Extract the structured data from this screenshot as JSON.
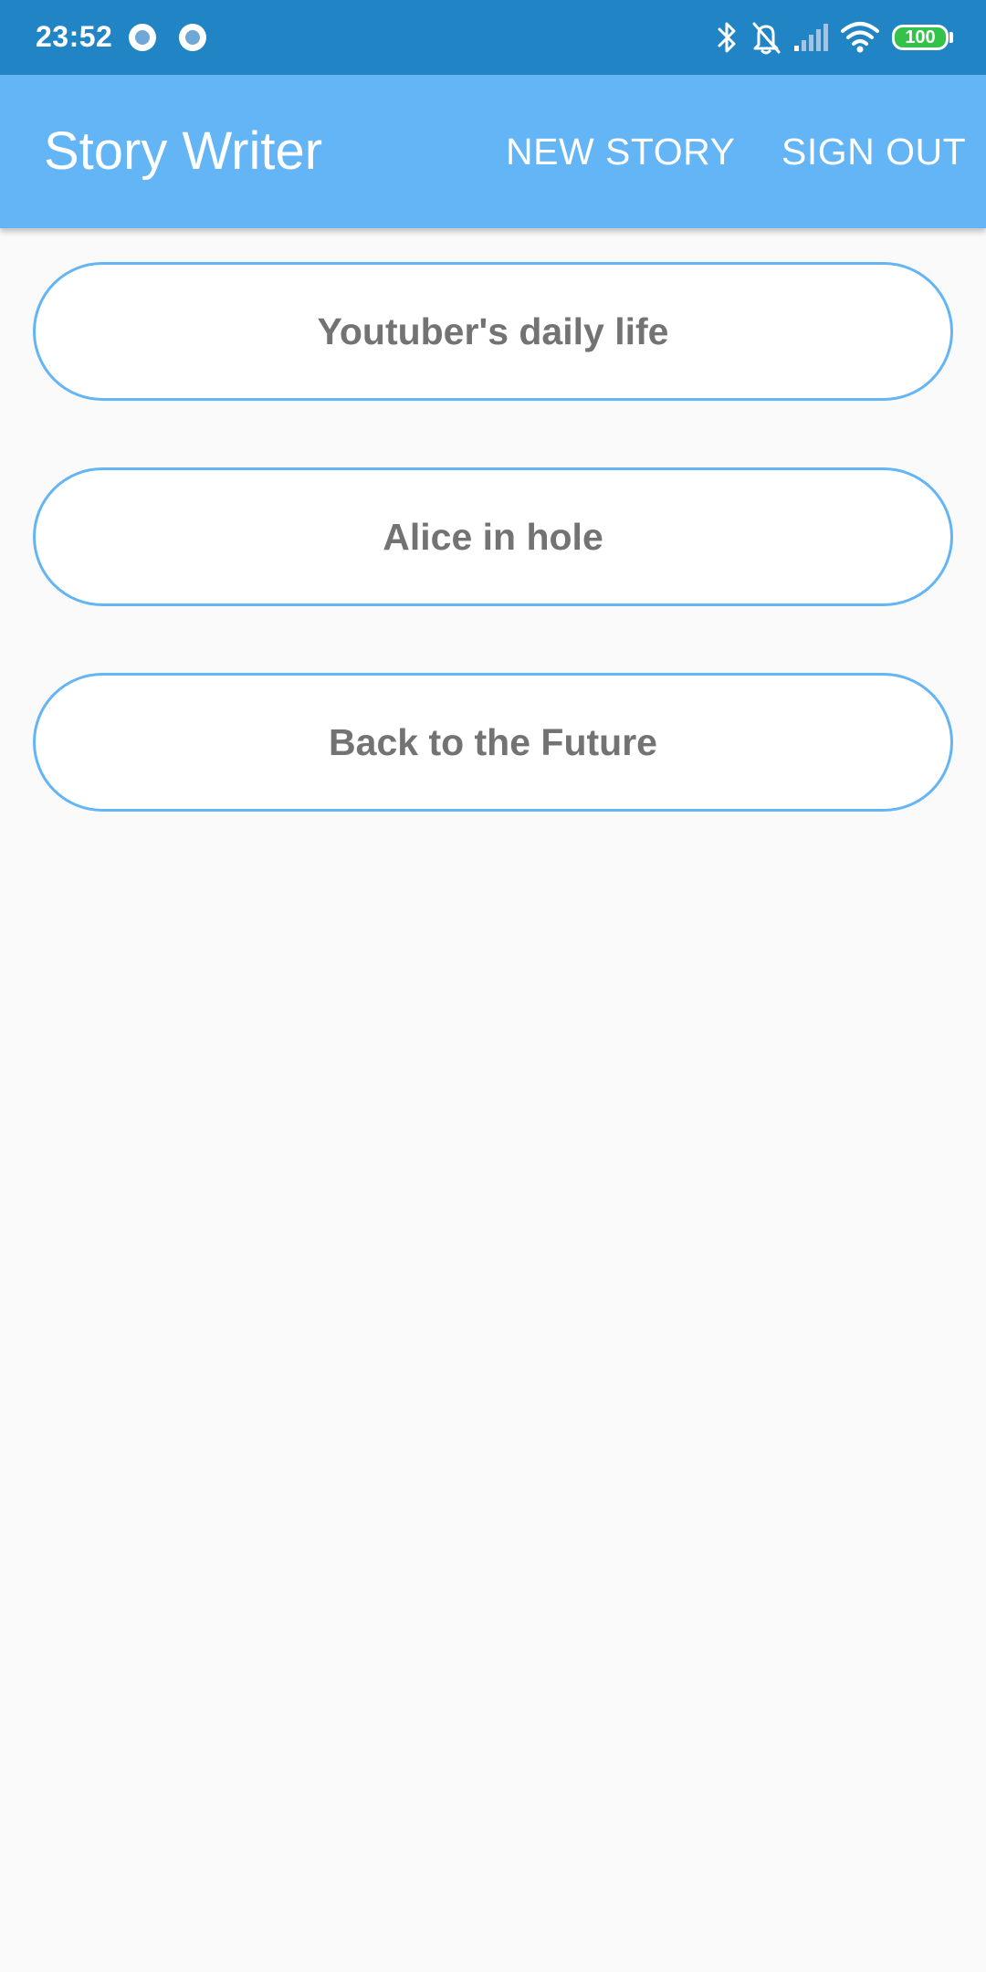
{
  "status_bar": {
    "time": "23:52",
    "battery": "100",
    "icons": [
      "notification-circle-icon",
      "notification-circle-icon",
      "bluetooth-icon",
      "bell-off-icon",
      "cell-signal-icon",
      "wifi-icon",
      "battery-icon"
    ]
  },
  "app_bar": {
    "title": "Story Writer",
    "new_story_label": "NEW STORY",
    "sign_out_label": "SIGN OUT"
  },
  "stories": [
    {
      "title": "Youtuber's daily life"
    },
    {
      "title": "Alice in hole"
    },
    {
      "title": "Back to the Future"
    }
  ],
  "colors": {
    "status_bar": "#2185c5",
    "app_bar": "#64b5f6",
    "button_border": "#64b5f6",
    "button_text": "#737373",
    "background": "#fafafa",
    "battery_fill": "#35c24a"
  }
}
